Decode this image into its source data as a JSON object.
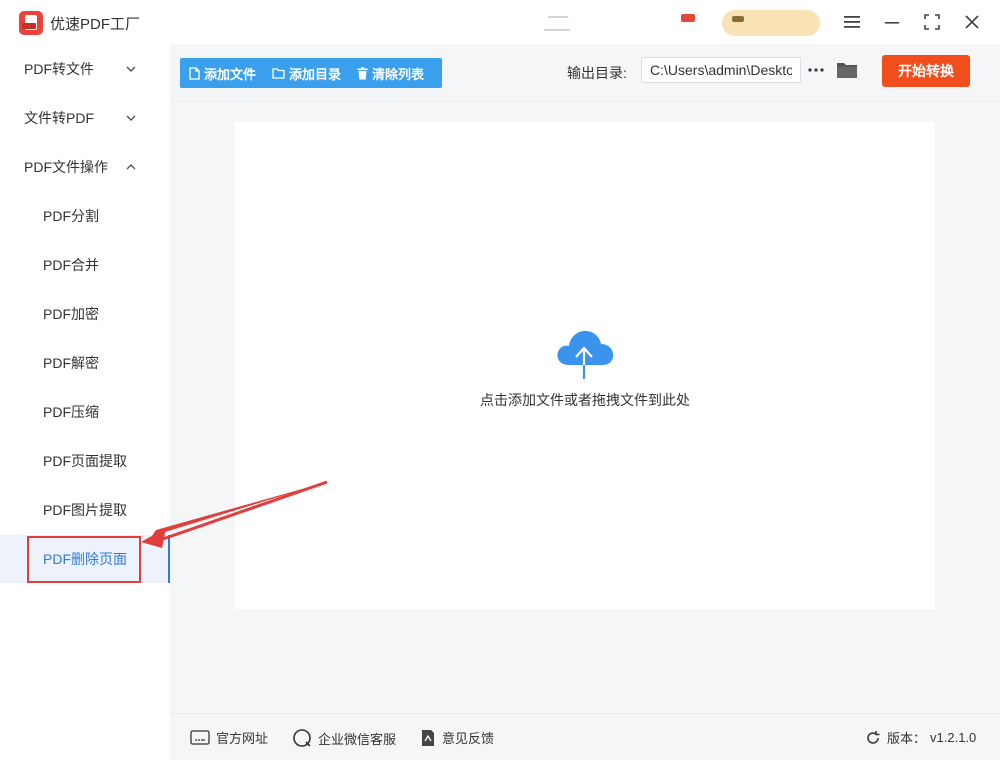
{
  "app": {
    "title": "优速PDF工厂"
  },
  "sidebar": {
    "groups": [
      {
        "label": "PDF转文件"
      },
      {
        "label": "文件转PDF"
      },
      {
        "label": "PDF文件操作"
      }
    ],
    "subitems": [
      {
        "label": "PDF分割"
      },
      {
        "label": "PDF合并"
      },
      {
        "label": "PDF加密"
      },
      {
        "label": "PDF解密"
      },
      {
        "label": "PDF压缩"
      },
      {
        "label": "PDF页面提取"
      },
      {
        "label": "PDF图片提取"
      },
      {
        "label": "PDF删除页面"
      }
    ],
    "active": "PDF删除页面"
  },
  "toolbar": {
    "add_file": "添加文件",
    "add_folder": "添加目录",
    "clear_list": "清除列表",
    "output_label": "输出目录:",
    "output_path": "C:\\Users\\admin\\Desktop",
    "start": "开始转换"
  },
  "dropzone": {
    "hint": "点击添加文件或者拖拽文件到此处"
  },
  "footer": {
    "website": "官方网址",
    "wechat": "企业微信客服",
    "feedback": "意见反馈",
    "version_label": "版本：",
    "version": "v1.2.1.0"
  },
  "colors": {
    "accent": "#3aa0ee",
    "start_button": "#f24d1d",
    "active_text": "#2f7bd8",
    "annotation": "#e23d3d"
  },
  "icons": [
    "app-logo",
    "menu-icon",
    "minimize-icon",
    "maximize-icon",
    "close-icon",
    "chevron-down-icon",
    "chevron-up-icon",
    "file-icon",
    "folder-icon",
    "trash-icon",
    "more-icon",
    "cloud-upload-icon",
    "website-icon",
    "wechat-icon",
    "feedback-icon",
    "refresh-icon",
    "red-arrow"
  ]
}
